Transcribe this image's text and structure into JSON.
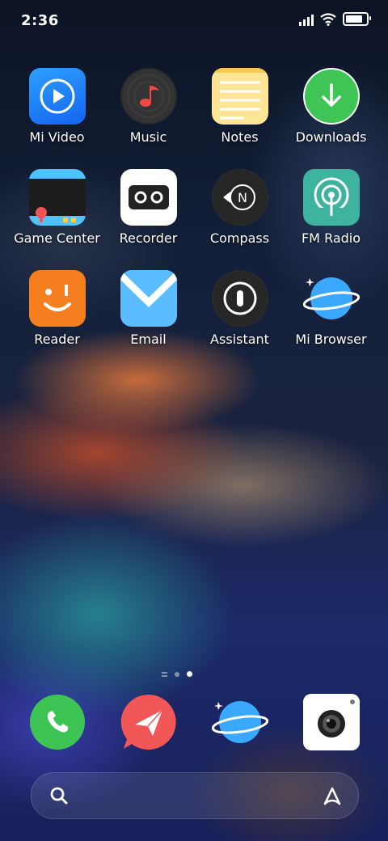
{
  "status_bar": {
    "time": "2:36",
    "icons": [
      "signal-icon",
      "wifi-icon",
      "battery-icon"
    ]
  },
  "home_screen": {
    "apps": [
      {
        "label": "Mi Video",
        "icon": "play-icon",
        "color": "#1e88ff"
      },
      {
        "label": "Music",
        "icon": "music-note-icon",
        "color": "#2a2a2a"
      },
      {
        "label": "Notes",
        "icon": "notes-icon",
        "color": "#ffe08a"
      },
      {
        "label": "Downloads",
        "icon": "download-arrow-icon",
        "color": "#3ec455"
      },
      {
        "label": "Game Center",
        "icon": "gamepad-icon",
        "color": "#1f1f1f"
      },
      {
        "label": "Recorder",
        "icon": "cassette-icon",
        "color": "#ffffff"
      },
      {
        "label": "Compass",
        "icon": "compass-icon",
        "color": "#2a2a2a"
      },
      {
        "label": "FM Radio",
        "icon": "radio-antenna-icon",
        "color": "#3db3a0"
      },
      {
        "label": "Reader",
        "icon": "smiley-icon",
        "color": "#f57f1f"
      },
      {
        "label": "Email",
        "icon": "envelope-icon",
        "color": "#4fb6ff"
      },
      {
        "label": "Assistant",
        "icon": "assistant-icon",
        "color": "#2a2a2a"
      },
      {
        "label": "Mi Browser",
        "icon": "planet-icon",
        "color": "#3aa8ff"
      }
    ],
    "page_indicator": {
      "pages": 2,
      "active": 2
    }
  },
  "dock": {
    "apps": [
      {
        "name": "phone",
        "icon": "phone-icon",
        "color": "#3ec455"
      },
      {
        "name": "messaging",
        "icon": "paper-plane-icon",
        "color": "#f05454"
      },
      {
        "name": "browser",
        "icon": "planet-icon",
        "color": "#3aa8ff"
      },
      {
        "name": "camera",
        "icon": "camera-icon",
        "color": "#ffffff"
      }
    ]
  },
  "search_bar": {
    "left_icon": "search-icon",
    "right_icon": "assistant-a-icon"
  }
}
